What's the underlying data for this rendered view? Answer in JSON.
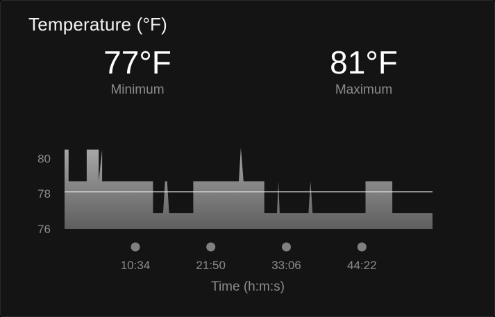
{
  "card": {
    "title": "Temperature (°F)"
  },
  "stats": {
    "minimum_value": "77°F",
    "minimum_label": "Minimum",
    "maximum_value": "81°F",
    "maximum_label": "Maximum"
  },
  "colors": {
    "background": "#141414",
    "area_top": "#a8a8a8",
    "area_bottom": "#5e5e5e",
    "reference_line": "#e8e8e8",
    "tick_text": "#8c8c8c",
    "marker": "#808080"
  },
  "chart_data": {
    "type": "area",
    "xlabel": "Time (h:m:s)",
    "x_ticks": [
      "10:34",
      "21:50",
      "33:06",
      "44:22"
    ],
    "x_tick_minutes": [
      10.57,
      21.83,
      33.1,
      44.37
    ],
    "y_ticks": [
      76,
      78,
      80
    ],
    "ylim": [
      76,
      80.8
    ],
    "xlim": [
      0,
      54.9
    ],
    "reference_value": 78.1,
    "grid": false,
    "series": [
      {
        "x": [
          0,
          0.6,
          0.6,
          3.3,
          3.3,
          5.1,
          5.1,
          5.6,
          5.6,
          6.0,
          6.0,
          13.2,
          13.2,
          14.7,
          15.0,
          15.3,
          15.6,
          16.0,
          16.0,
          19.2,
          19.2,
          26.0,
          26.3,
          26.7,
          29.8,
          29.8,
          31.7,
          31.9,
          32.1,
          36.4,
          36.7,
          37.0,
          44.9,
          44.9,
          48.9,
          48.9,
          54.9
        ],
        "values": [
          80.5,
          80.5,
          78.7,
          78.7,
          80.5,
          80.5,
          78.7,
          80.5,
          78.7,
          78.7,
          78.7,
          78.7,
          76.9,
          76.9,
          78.7,
          78.7,
          76.9,
          76.9,
          76.9,
          76.9,
          78.7,
          78.7,
          80.6,
          78.7,
          78.7,
          76.9,
          76.9,
          78.7,
          76.9,
          76.9,
          78.7,
          76.9,
          76.9,
          78.7,
          78.7,
          76.9,
          76.9
        ]
      }
    ]
  }
}
